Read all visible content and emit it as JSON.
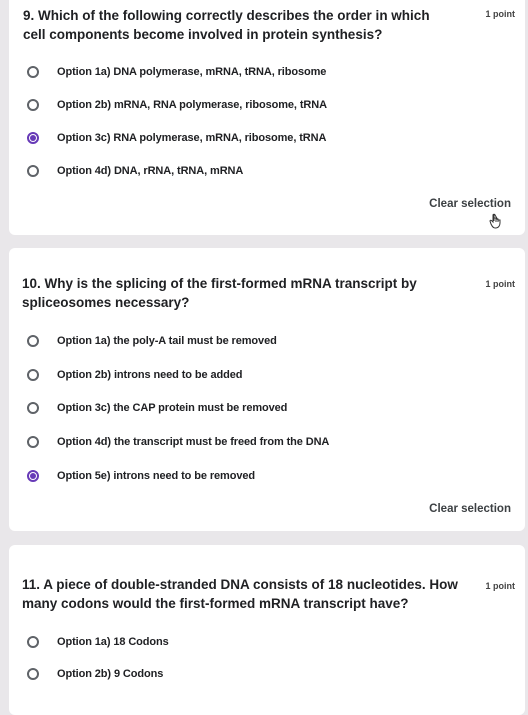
{
  "q9": {
    "text": "9. Which of the following correctly describes the order in which cell components become involved in protein synthesis?",
    "points": "1 point",
    "options": [
      {
        "label": "Option 1a) DNA polymerase, mRNA, tRNA, ribosome",
        "selected": false
      },
      {
        "label": "Option 2b) mRNA, RNA polymerase, ribosome, tRNA",
        "selected": false
      },
      {
        "label": "Option 3c) RNA polymerase, mRNA, ribosome, tRNA",
        "selected": true
      },
      {
        "label": "Option 4d) DNA, rRNA, tRNA, mRNA",
        "selected": false
      }
    ],
    "clear_label": "Clear selection",
    "cursor_icon": "hand-pointer-icon"
  },
  "q10": {
    "text": "10. Why is the splicing of the first-formed mRNA transcript by spliceosomes necessary?",
    "points": "1 point",
    "options": [
      {
        "label": "Option 1a) the poly-A tail must be removed",
        "selected": false
      },
      {
        "label": "Option 2b) introns need to be added",
        "selected": false
      },
      {
        "label": "Option 3c) the CAP protein must be removed",
        "selected": false
      },
      {
        "label": "Option 4d) the transcript must be freed from the DNA",
        "selected": false
      },
      {
        "label": "Option 5e) introns need to be removed",
        "selected": true
      }
    ],
    "clear_label": "Clear selection"
  },
  "q11": {
    "text": "11. A piece of double-stranded DNA consists of 18 nucleotides. How many codons would the first-formed mRNA transcript have?",
    "points": "1 point",
    "options": [
      {
        "label": "Option 1a) 18 Codons",
        "selected": false
      },
      {
        "label": "Option 2b) 9 Codons",
        "selected": false
      }
    ]
  },
  "colors": {
    "accent": "#673ab7",
    "background": "#e9e7ea",
    "card": "#ffffff"
  }
}
